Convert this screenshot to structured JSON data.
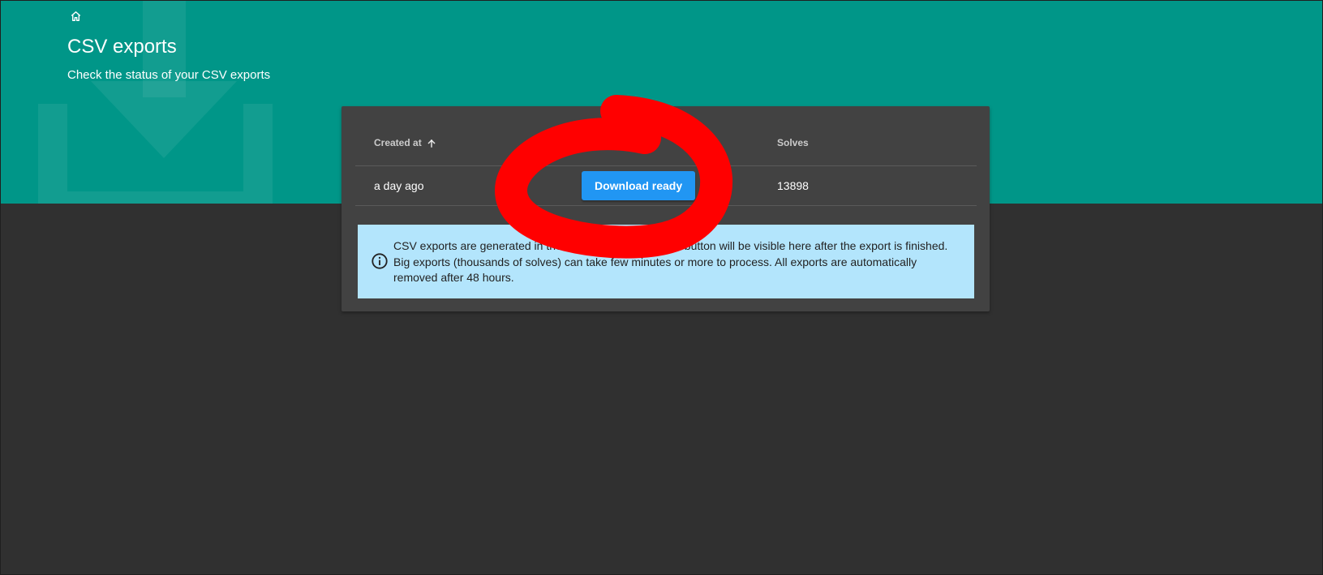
{
  "header": {
    "home_icon": "home-icon",
    "title": "CSV exports",
    "subtitle": "Check the status of your CSV exports",
    "background_icon": "download-icon",
    "background_color": "#009688"
  },
  "table": {
    "columns": [
      {
        "label": "Created at",
        "sort": "ascending",
        "sort_icon": "arrow-up-icon"
      },
      {
        "label": "Status"
      },
      {
        "label": "Solves"
      }
    ],
    "rows": [
      {
        "created_at": "a day ago",
        "status_button": "Download ready",
        "solves": "13898"
      }
    ]
  },
  "info_alert": {
    "icon": "info-icon",
    "text": "CSV exports are generated in the background. Download button will be visible here after the export is finished. Big exports (thousands of solves) can take few minutes or more to process. All exports are automatically removed after 48 hours.",
    "background_color": "#b3e5fc"
  },
  "annotation": {
    "shape": "hand-drawn circle",
    "color": "#ff0000"
  },
  "colors": {
    "page_background": "#303030",
    "card_background": "#424242",
    "button_primary": "#2196f3"
  }
}
